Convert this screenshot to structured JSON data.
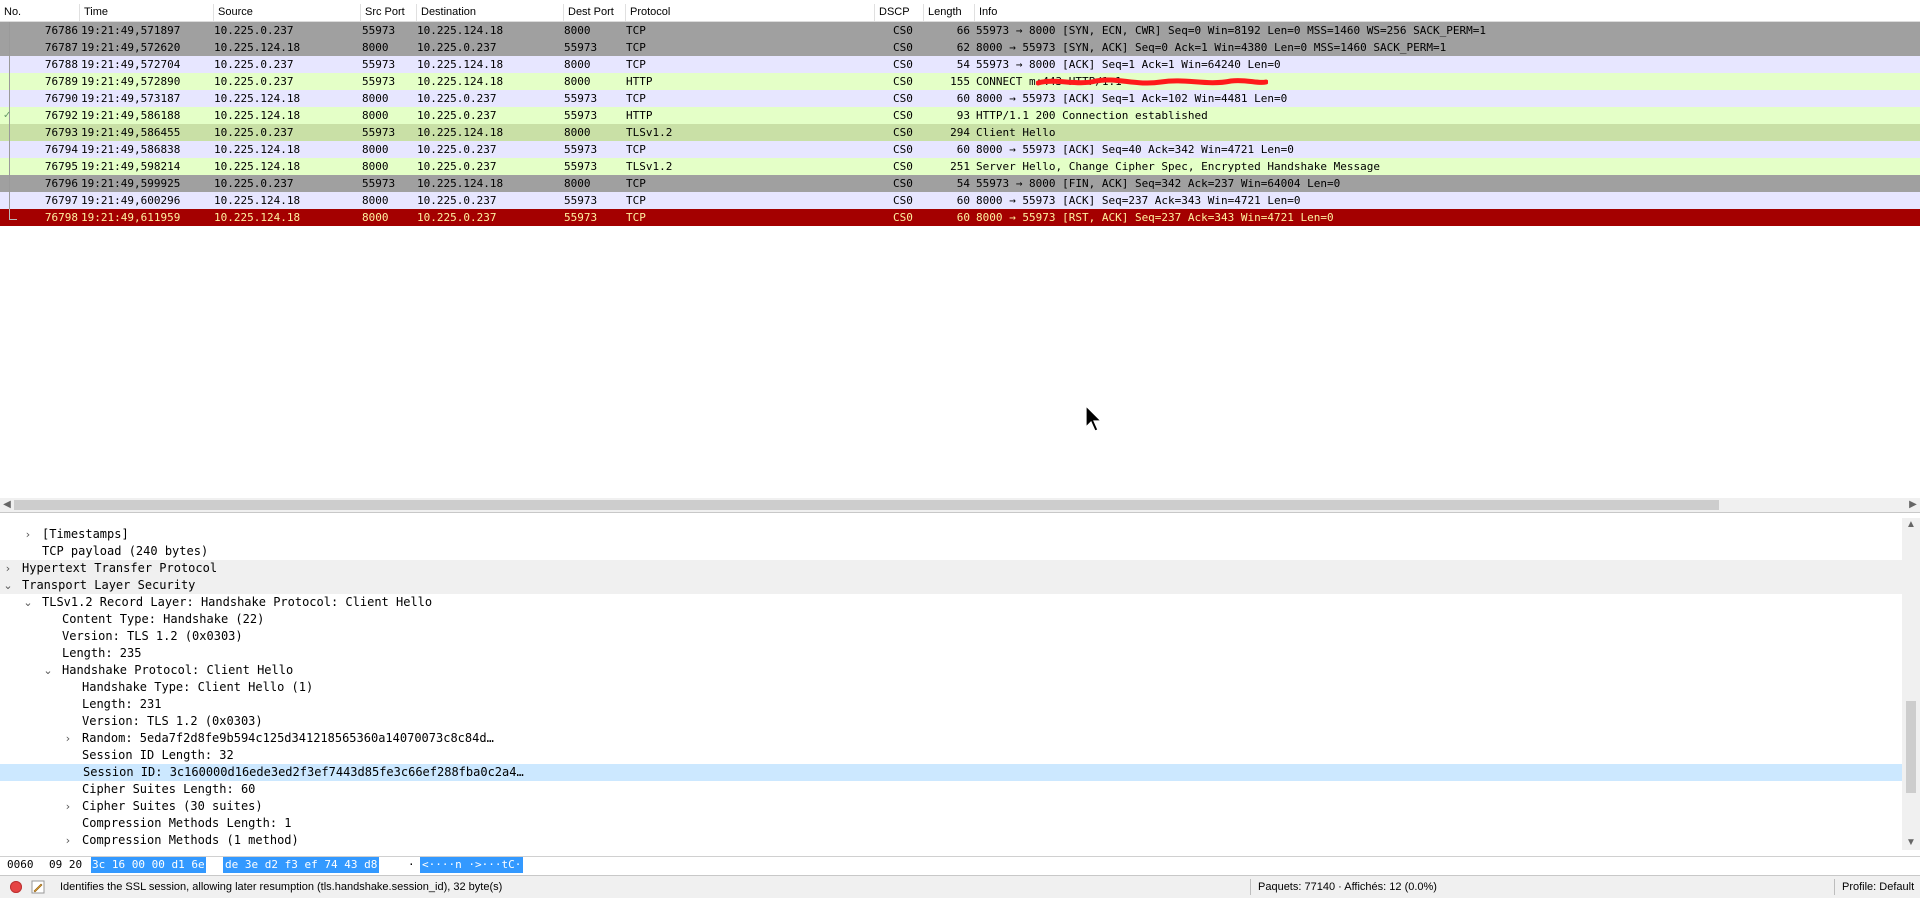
{
  "colors": {
    "tcp_row": "#e7e6ff",
    "http_row": "#e4ffc7",
    "tls_row": "#e4ffc7",
    "tls_hello_row": "#c9e0a6",
    "grey_row": "#a0a0a0",
    "rst_row": "#a40000",
    "selected_detail": "#cce8ff"
  },
  "columns": [
    "No.",
    "Time",
    "Source",
    "Src Port",
    "Destination",
    "Dest Port",
    "Protocol",
    "DSCP",
    "Length",
    "Info"
  ],
  "packets": [
    {
      "no": "76786",
      "time": "19:21:49,571897",
      "src": "10.225.0.237",
      "sport": "55973",
      "dst": "10.225.124.18",
      "dport": "8000",
      "proto": "TCP",
      "dscp": "CS0",
      "len": "66",
      "info": "55973 → 8000 [SYN, ECN, CWR] Seq=0 Win=8192 Len=0 MSS=1460 WS=256 SACK_PERM=1",
      "style": "grey"
    },
    {
      "no": "76787",
      "time": "19:21:49,572620",
      "src": "10.225.124.18",
      "sport": "8000",
      "dst": "10.225.0.237",
      "dport": "55973",
      "proto": "TCP",
      "dscp": "CS0",
      "len": "62",
      "info": "8000 → 55973 [SYN, ACK] Seq=0 Ack=1 Win=4380 Len=0 MSS=1460 SACK_PERM=1",
      "style": "grey"
    },
    {
      "no": "76788",
      "time": "19:21:49,572704",
      "src": "10.225.0.237",
      "sport": "55973",
      "dst": "10.225.124.18",
      "dport": "8000",
      "proto": "TCP",
      "dscp": "CS0",
      "len": "54",
      "info": "55973 → 8000 [ACK] Seq=1 Ack=1 Win=64240 Len=0",
      "style": "tcp"
    },
    {
      "no": "76789",
      "time": "19:21:49,572890",
      "src": "10.225.0.237",
      "sport": "55973",
      "dst": "10.225.124.18",
      "dport": "8000",
      "proto": "HTTP",
      "dscp": "CS0",
      "len": "155",
      "info": "CONNECT                                     m:443 HTTP/1.1",
      "style": "http",
      "scribble": true
    },
    {
      "no": "76790",
      "time": "19:21:49,573187",
      "src": "10.225.124.18",
      "sport": "8000",
      "dst": "10.225.0.237",
      "dport": "55973",
      "proto": "TCP",
      "dscp": "CS0",
      "len": "60",
      "info": "8000 → 55973 [ACK] Seq=1 Ack=102 Win=4481 Len=0",
      "style": "tcp"
    },
    {
      "no": "76792",
      "time": "19:21:49,586188",
      "src": "10.225.124.18",
      "sport": "8000",
      "dst": "10.225.0.237",
      "dport": "55973",
      "proto": "HTTP",
      "dscp": "CS0",
      "len": "93",
      "info": "HTTP/1.1 200 Connection established",
      "style": "http",
      "check": true
    },
    {
      "no": "76793",
      "time": "19:21:49,586455",
      "src": "10.225.0.237",
      "sport": "55973",
      "dst": "10.225.124.18",
      "dport": "8000",
      "proto": "TLSv1.2",
      "dscp": "CS0",
      "len": "294",
      "info": "Client Hello",
      "style": "tlshello"
    },
    {
      "no": "76794",
      "time": "19:21:49,586838",
      "src": "10.225.124.18",
      "sport": "8000",
      "dst": "10.225.0.237",
      "dport": "55973",
      "proto": "TCP",
      "dscp": "CS0",
      "len": "60",
      "info": "8000 → 55973 [ACK] Seq=40 Ack=342 Win=4721 Len=0",
      "style": "tcp"
    },
    {
      "no": "76795",
      "time": "19:21:49,598214",
      "src": "10.225.124.18",
      "sport": "8000",
      "dst": "10.225.0.237",
      "dport": "55973",
      "proto": "TLSv1.2",
      "dscp": "CS0",
      "len": "251",
      "info": "Server Hello, Change Cipher Spec, Encrypted Handshake Message",
      "style": "tls"
    },
    {
      "no": "76796",
      "time": "19:21:49,599925",
      "src": "10.225.0.237",
      "sport": "55973",
      "dst": "10.225.124.18",
      "dport": "8000",
      "proto": "TCP",
      "dscp": "CS0",
      "len": "54",
      "info": "55973 → 8000 [FIN, ACK] Seq=342 Ack=237 Win=64004 Len=0",
      "style": "grey"
    },
    {
      "no": "76797",
      "time": "19:21:49,600296",
      "src": "10.225.124.18",
      "sport": "8000",
      "dst": "10.225.0.237",
      "dport": "55973",
      "proto": "TCP",
      "dscp": "CS0",
      "len": "60",
      "info": "8000 → 55973 [ACK] Seq=237 Ack=343 Win=4721 Len=0",
      "style": "tcp"
    },
    {
      "no": "76798",
      "time": "19:21:49,611959",
      "src": "10.225.124.18",
      "sport": "8000",
      "dst": "10.225.0.237",
      "dport": "55973",
      "proto": "TCP",
      "dscp": "CS0",
      "len": "60",
      "info": "8000 → 55973 [RST, ACK] Seq=237 Ack=343 Win=4721 Len=0",
      "style": "rst",
      "end": true
    }
  ],
  "details": [
    {
      "text": "[Timestamps]",
      "level": 2,
      "arrow": "right",
      "shaded": false
    },
    {
      "text": "TCP payload (240 bytes)",
      "level": 2,
      "arrow": "",
      "shaded": false
    },
    {
      "text": "Hypertext Transfer Protocol",
      "level": 1,
      "arrow": "right",
      "shaded": true
    },
    {
      "text": "Transport Layer Security",
      "level": 1,
      "arrow": "down",
      "shaded": true
    },
    {
      "text": "TLSv1.2 Record Layer: Handshake Protocol: Client Hello",
      "level": 2,
      "arrow": "down",
      "shaded": false
    },
    {
      "text": "Content Type: Handshake (22)",
      "level": 3,
      "arrow": "",
      "shaded": false
    },
    {
      "text": "Version: TLS 1.2 (0x0303)",
      "level": 3,
      "arrow": "",
      "shaded": false
    },
    {
      "text": "Length: 235",
      "level": 3,
      "arrow": "",
      "shaded": false
    },
    {
      "text": "Handshake Protocol: Client Hello",
      "level": 3,
      "arrow": "down",
      "shaded": false
    },
    {
      "text": "Handshake Type: Client Hello (1)",
      "level": 4,
      "arrow": "",
      "shaded": false
    },
    {
      "text": "Length: 231",
      "level": 4,
      "arrow": "",
      "shaded": false
    },
    {
      "text": "Version: TLS 1.2 (0x0303)",
      "level": 4,
      "arrow": "",
      "shaded": false
    },
    {
      "text": "Random: 5eda7f2d8fe9b594c125d341218565360a14070073c8c84d…",
      "level": 4,
      "arrow": "right",
      "shaded": false
    },
    {
      "text": "Session ID Length: 32",
      "level": 4,
      "arrow": "",
      "shaded": false
    },
    {
      "text": "Session ID: 3c160000d16ede3ed2f3ef7443d85fe3c66ef288fba0c2a4…",
      "level": 4,
      "arrow": "",
      "shaded": false,
      "selected": true
    },
    {
      "text": "Cipher Suites Length: 60",
      "level": 4,
      "arrow": "",
      "shaded": false
    },
    {
      "text": "Cipher Suites (30 suites)",
      "level": 4,
      "arrow": "right",
      "shaded": false
    },
    {
      "text": "Compression Methods Length: 1",
      "level": 4,
      "arrow": "",
      "shaded": false
    },
    {
      "text": "Compression Methods (1 method)",
      "level": 4,
      "arrow": "right",
      "shaded": false
    }
  ],
  "bytes": {
    "offset": "0060",
    "pre_hex": "09 20",
    "hex_sel_a": "3c 16 00 00 d1 6e",
    "hex_sel_b": "de 3e d2 f3 ef 74 43 d8",
    "ascii_pre": "·",
    "ascii_sel": "<····n ·>···tC·"
  },
  "status": {
    "message": "Identifies the SSL session, allowing later resumption (tls.handshake.session_id), 32 byte(s)",
    "packets": "Paquets: 77140 · Affichés: 12 (0.0%)",
    "profile": "Profile: Default"
  }
}
